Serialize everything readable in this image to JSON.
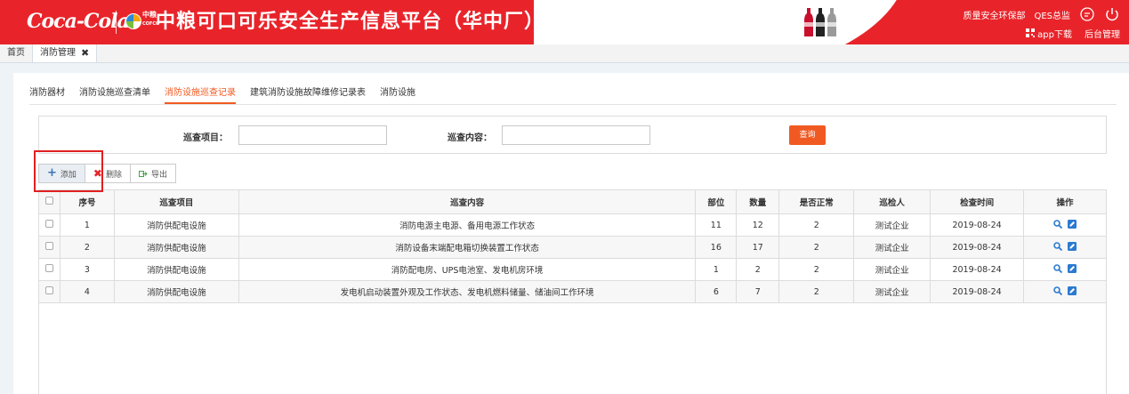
{
  "header": {
    "brand_script": "Coca-Cola",
    "cofco_cn": "中粮",
    "cofco_en": "COFCO",
    "title": "中粮可口可乐安全生产信息平台（华中厂）",
    "links": [
      "质量安全环保部",
      "QES总监"
    ],
    "app_download": "app下载",
    "admin": "后台管理",
    "colors": {
      "brand_red": "#e8242a",
      "accent_orange": "#f05a22"
    }
  },
  "page_tabs": [
    {
      "label": "首页"
    },
    {
      "label": "消防管理",
      "close": "✖"
    }
  ],
  "subtabs": [
    {
      "label": "消防器材"
    },
    {
      "label": "消防设施巡查清单"
    },
    {
      "label": "消防设施巡查记录",
      "active": true
    },
    {
      "label": "建筑消防设施故障维修记录表"
    },
    {
      "label": "消防设施"
    }
  ],
  "search": {
    "item_label": "巡查项目：",
    "item_value": "",
    "content_label": "巡查内容：",
    "content_value": "",
    "button": "查询"
  },
  "toolbar": {
    "add": "添加",
    "delete": "删除",
    "export": "导出"
  },
  "table": {
    "columns": [
      "序号",
      "巡查项目",
      "巡查内容",
      "部位",
      "数量",
      "是否正常",
      "巡检人",
      "检查时间",
      "操作"
    ],
    "rows": [
      {
        "no": "1",
        "item": "消防供配电设施",
        "content": "消防电源主电源、备用电源工作状态",
        "part": "11",
        "qty": "12",
        "normal": "2",
        "inspector": "测试企业",
        "date": "2019-08-24"
      },
      {
        "no": "2",
        "item": "消防供配电设施",
        "content": "消防设备末端配电箱切换装置工作状态",
        "part": "16",
        "qty": "17",
        "normal": "2",
        "inspector": "测试企业",
        "date": "2019-08-24"
      },
      {
        "no": "3",
        "item": "消防供配电设施",
        "content": "消防配电房、UPS电池室、发电机房环境",
        "part": "1",
        "qty": "2",
        "normal": "2",
        "inspector": "测试企业",
        "date": "2019-08-24"
      },
      {
        "no": "4",
        "item": "消防供配电设施",
        "content": "发电机启动装置外观及工作状态、发电机燃料储量、储油间工作环境",
        "part": "6",
        "qty": "7",
        "normal": "2",
        "inspector": "测试企业",
        "date": "2019-08-24"
      }
    ]
  }
}
